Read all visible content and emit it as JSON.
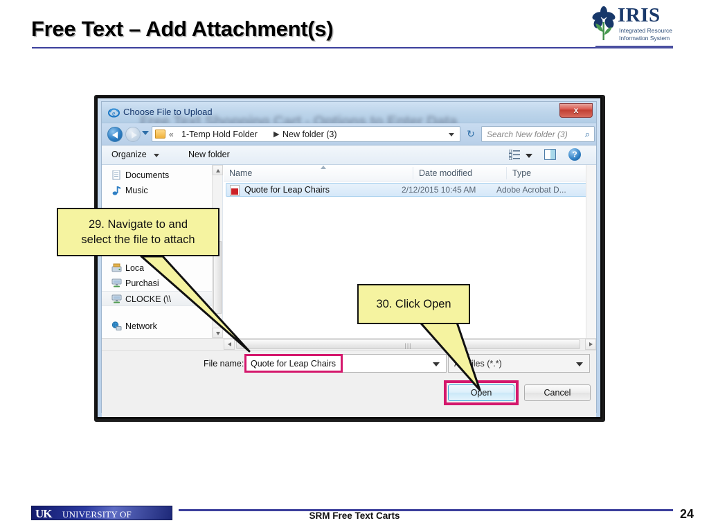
{
  "slide": {
    "title": "Free Text – Add Attachment(s)",
    "ghost_text": "Free Text Shopping Cart - Options to Enter Data",
    "logo": {
      "word": "IRIS",
      "sub_line1": "Integrated Resource",
      "sub_line2": "Information System",
      "accent_color": "#1b3a6b"
    },
    "footer": {
      "uk_abbr": "UK",
      "uk_name": "UNIVERSITY OF KENTUCKY",
      "center_text": "SRM Free Text Carts",
      "page_number": "24",
      "rule_color": "#3b3f9c"
    }
  },
  "dialog": {
    "titlebar": {
      "title": "Choose File to Upload",
      "app_icon": "ie-icon",
      "close_label": "x"
    },
    "navbar": {
      "back_icon": "back-arrow-icon",
      "forward_icon": "forward-arrow-icon",
      "history_icon": "chevron-down-icon",
      "folder_icon": "folder-icon",
      "crumb_chevron": "«",
      "crumb1": "1-Temp Hold Folder",
      "crumb_separator": "▶",
      "crumb2": "New folder (3)",
      "address_dropdown_icon": "chevron-down-icon",
      "refresh_icon": "↻",
      "search_placeholder": "Search New folder (3)",
      "search_value": "",
      "search_icon": "search-icon"
    },
    "toolbar": {
      "organize_label": "Organize",
      "organize_arrow_icon": "chevron-down-icon",
      "new_folder_label": "New folder",
      "view_icon": "view-list-icon",
      "view_arrow_icon": "chevron-down-icon",
      "preview_pane_icon": "preview-pane-icon",
      "help_icon": "?"
    },
    "sidebar": {
      "items": [
        {
          "label": "Documents",
          "icon": "document-icon",
          "selected": false
        },
        {
          "label": "Music",
          "icon": "music-note-icon",
          "selected": false
        },
        {
          "label": "Loca",
          "icon": "local-disk-icon",
          "selected": false
        },
        {
          "label": "Purchasi",
          "icon": "network-drive-icon",
          "selected": false
        },
        {
          "label": "CLOCKE (\\\\",
          "icon": "network-drive-icon",
          "selected": true
        },
        {
          "label": "Network",
          "icon": "network-icon",
          "selected": false
        }
      ]
    },
    "file_list": {
      "columns": [
        "Name",
        "Date modified",
        "Type"
      ],
      "rows": [
        {
          "name": "Quote for Leap Chairs",
          "date_modified": "2/12/2015 10:45 AM",
          "type": "Adobe Acrobat D...",
          "icon": "pdf-file-icon",
          "selected": true
        }
      ]
    },
    "footer": {
      "file_name_label": "File name:",
      "file_name_value": "Quote for Leap Chairs",
      "file_name_dropdown_icon": "chevron-down-icon",
      "filter_value": "All Files (*.*)",
      "filter_dropdown_icon": "chevron-down-icon",
      "open_label": "Open",
      "cancel_label": "Cancel",
      "highlight_color": "#d4176c"
    }
  },
  "callouts": [
    {
      "id": "callout-29",
      "line1": "29. Navigate to and",
      "line2": "select the file to attach",
      "text": "29. Navigate to and select the file to attach"
    },
    {
      "id": "callout-30",
      "text": "30. Click Open"
    }
  ]
}
